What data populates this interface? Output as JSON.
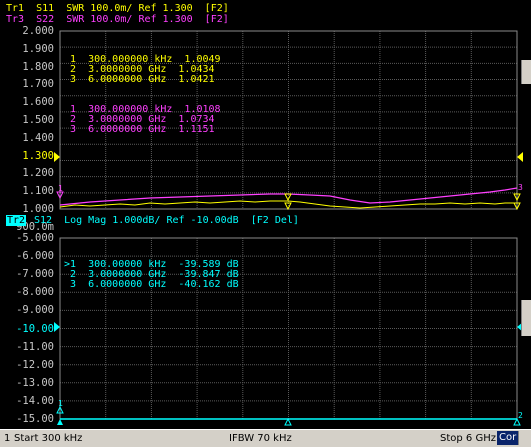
{
  "top_panel": {
    "header_line1": "Tr1  S11  SWR 100.0m/ Ref 1.300  [F2]",
    "header_line2": "Tr3  S22  SWR 100.0m/ Ref 1.300  [F2]",
    "y_labels": [
      "2.000",
      "1.900",
      "1.800",
      "1.700",
      "1.600",
      "1.500",
      "1.400",
      "1.300",
      "1.200",
      "1.100",
      "1.000",
      "900.0m"
    ],
    "ref_label": "1.300",
    "markers_tr1": [
      {
        "num": "1",
        "freq": "300.000000 kHz",
        "value": "1.0049"
      },
      {
        "num": "2",
        "freq": "3.0000000 GHz",
        "value": "1.0434"
      },
      {
        "num": "3",
        "freq": "6.0000000 GHz",
        "value": "1.0421"
      }
    ],
    "markers_tr3": [
      {
        "num": "1",
        "freq": "300.000000 kHz",
        "value": "1.0108"
      },
      {
        "num": "2",
        "freq": "3.0000000 GHz",
        "value": "1.0734"
      },
      {
        "num": "3",
        "freq": "6.0000000 GHz",
        "value": "1.1151"
      }
    ]
  },
  "bottom_panel": {
    "trace_tag": "Tr2",
    "header": "S12  Log Mag 1.000dB/ Ref -10.00dB  [F2 Del]",
    "y_labels": [
      "-5.000",
      "-6.000",
      "-7.000",
      "-8.000",
      "-9.000",
      "-10.00",
      "-11.00",
      "-12.00",
      "-13.00",
      "-14.00",
      "-15.00"
    ],
    "ref_label": "-10.00",
    "markers": [
      {
        "num": ">1",
        "freq": "300.00000 kHz",
        "value": "-39.589 dB"
      },
      {
        "num": "2",
        "freq": "3.0000000 GHz",
        "value": "-39.847 dB"
      },
      {
        "num": "3",
        "freq": "6.0000000 GHz",
        "value": "-40.162 dB"
      }
    ]
  },
  "status_bar": {
    "channel": "1",
    "start": "Start 300 kHz",
    "ifbw": "IFBW 70 kHz",
    "stop": "Stop 6 GHz",
    "cor": "Cor"
  },
  "colors": {
    "tr1": "#ffff00",
    "tr2": "#00ffff",
    "tr3": "#ff40ff",
    "grid": "#5a5a5a",
    "label": "#c8c8c8"
  }
}
